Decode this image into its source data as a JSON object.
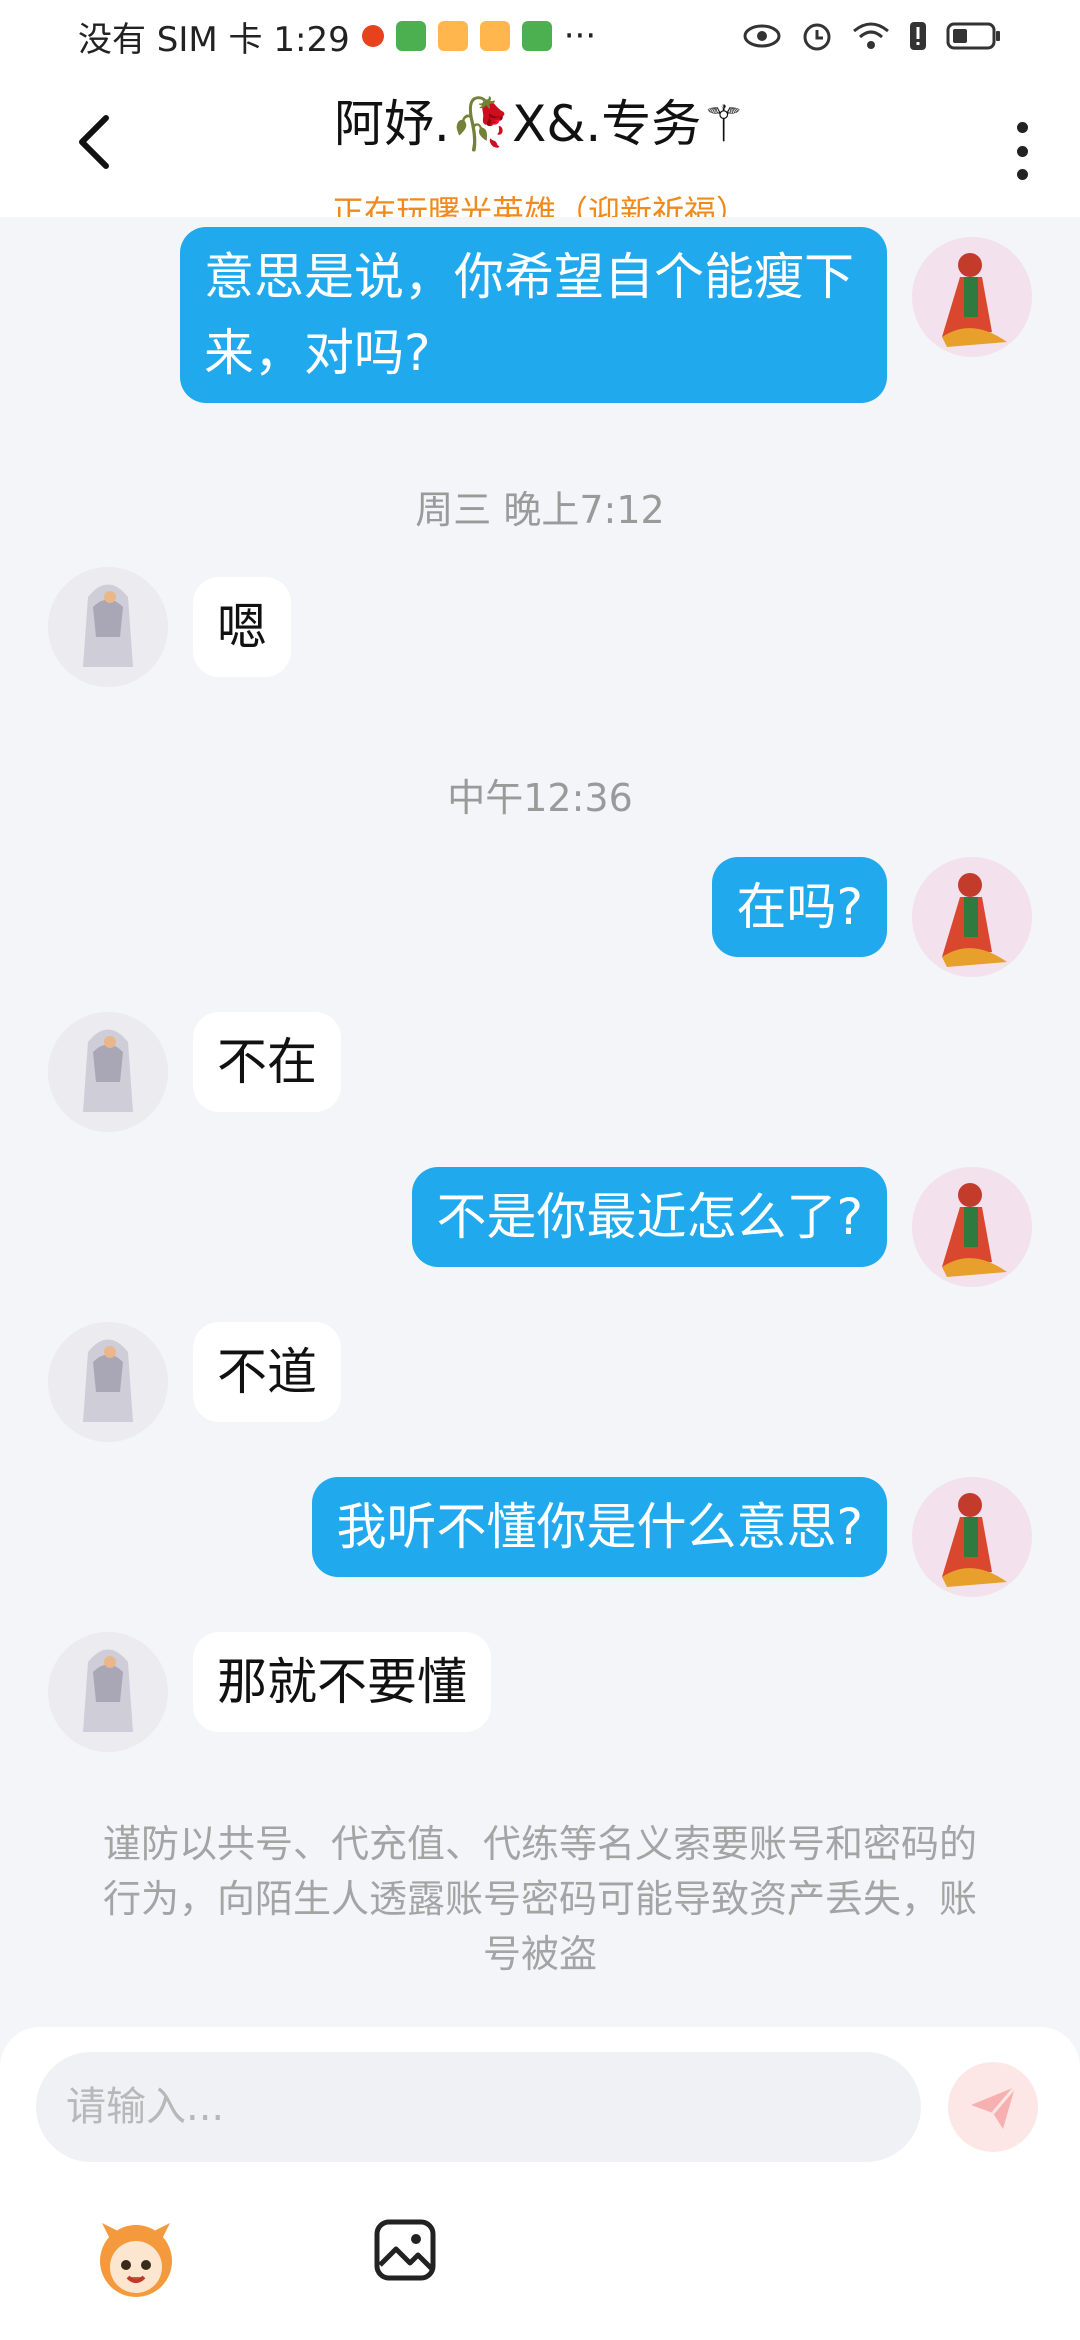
{
  "status_bar": {
    "carrier_time": "没有 SIM 卡 1:29",
    "more": "···"
  },
  "header": {
    "title": "阿妤.🥀X&.专务⚚",
    "subtitle": "正在玩曙光英雄（迎新祈福）"
  },
  "messages": [
    {
      "side": "me",
      "text": "意思是说，你希望自个能瘦下来，对吗?"
    },
    {
      "time": "周三 晚上7:12"
    },
    {
      "side": "them",
      "text": "嗯"
    },
    {
      "time": "中午12:36"
    },
    {
      "side": "me",
      "text": "在吗?"
    },
    {
      "side": "them",
      "text": "不在"
    },
    {
      "side": "me",
      "text": "不是你最近怎么了?"
    },
    {
      "side": "them",
      "text": "不道"
    },
    {
      "side": "me",
      "text": "我听不懂你是什么意思?"
    },
    {
      "side": "them",
      "text": "那就不要懂"
    }
  ],
  "notice": "谨防以共号、代充值、代练等名义索要账号和密码的行为，向陌生人透露账号密码可能导致资产丢失，账号被盗",
  "input": {
    "placeholder": "请输入..."
  },
  "colors": {
    "my_bubble": "#21a9ee",
    "their_bubble": "#ffffff",
    "subtitle": "#f08a1c",
    "background": "#f3f5f9"
  },
  "icons": [
    "back-arrow-icon",
    "more-vertical-icon",
    "send-icon",
    "emoji-mascot-icon",
    "image-icon",
    "eye-icon",
    "alarm-icon",
    "wifi-icon",
    "battery-icon"
  ]
}
